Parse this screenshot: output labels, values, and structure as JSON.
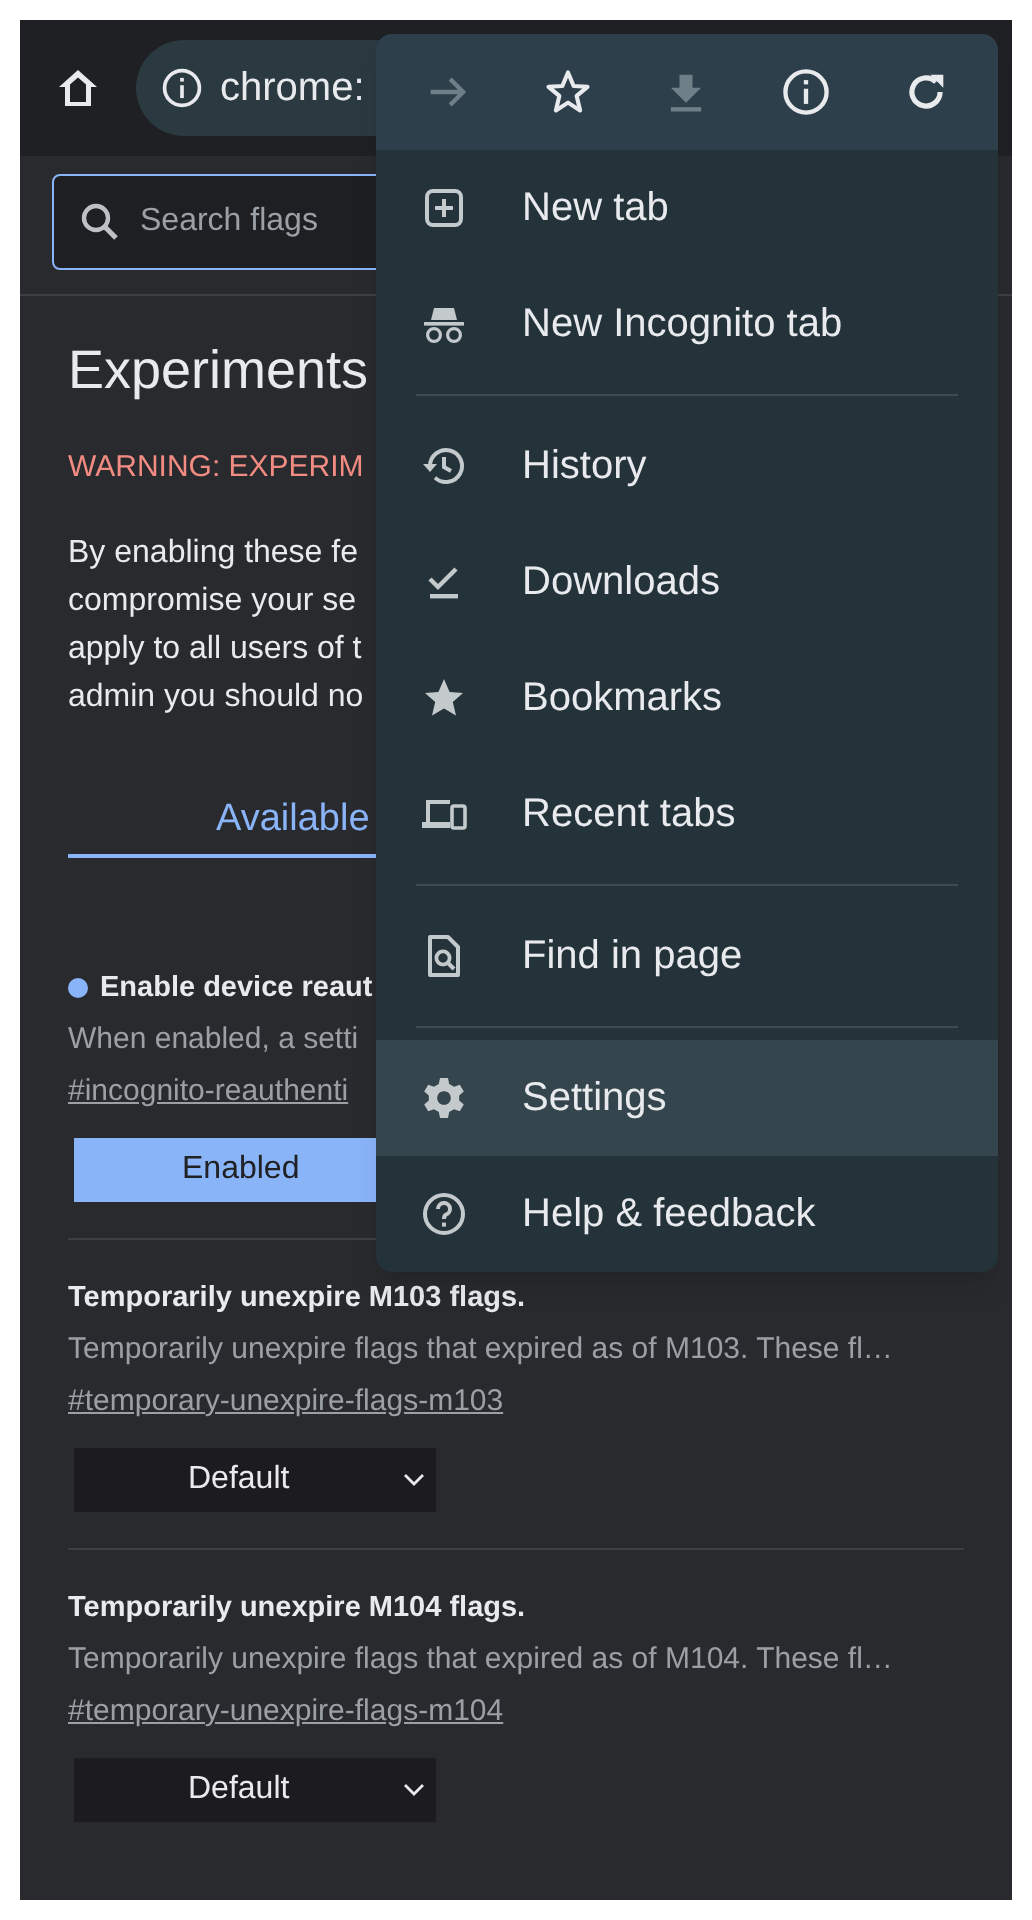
{
  "toolbar": {
    "url": "chrome:"
  },
  "search": {
    "placeholder": "Search flags"
  },
  "page": {
    "title": "Experiments",
    "warning": "WARNING: EXPERIM",
    "intro_lines": [
      "By enabling these fe",
      "compromise your se",
      "apply to all users of t",
      "admin you should no"
    ]
  },
  "tabs": [
    {
      "label": "Available",
      "selected": true
    }
  ],
  "flags": [
    {
      "title": "Enable device reaut",
      "description": "When enabled, a setti",
      "link": "#incognito-reauthenti",
      "value": "Enabled",
      "modified": true
    },
    {
      "title": "Temporarily unexpire M103 flags.",
      "description": "Temporarily unexpire flags that expired as of M103. These fl…",
      "link": "#temporary-unexpire-flags-m103",
      "value": "Default",
      "modified": false
    },
    {
      "title": "Temporarily unexpire M104 flags.",
      "description": "Temporarily unexpire flags that expired as of M104. These fl…",
      "link": "#temporary-unexpire-flags-m104",
      "value": "Default",
      "modified": false
    }
  ],
  "menu": {
    "actions": [
      {
        "disabled": true
      },
      {
        "disabled": false
      },
      {
        "disabled": true
      },
      {
        "disabled": false
      },
      {
        "disabled": false
      }
    ],
    "sections": [
      [
        {
          "label": "New tab",
          "selected": false
        },
        {
          "label": "New Incognito tab",
          "selected": false
        }
      ],
      [
        {
          "label": "History",
          "selected": false
        },
        {
          "label": "Downloads",
          "selected": false
        },
        {
          "label": "Bookmarks",
          "selected": false
        },
        {
          "label": "Recent tabs",
          "selected": false
        }
      ],
      [
        {
          "label": "Find in page",
          "selected": false
        }
      ],
      [
        {
          "label": "Settings",
          "selected": true
        },
        {
          "label": "Help & feedback",
          "selected": false
        }
      ]
    ]
  }
}
